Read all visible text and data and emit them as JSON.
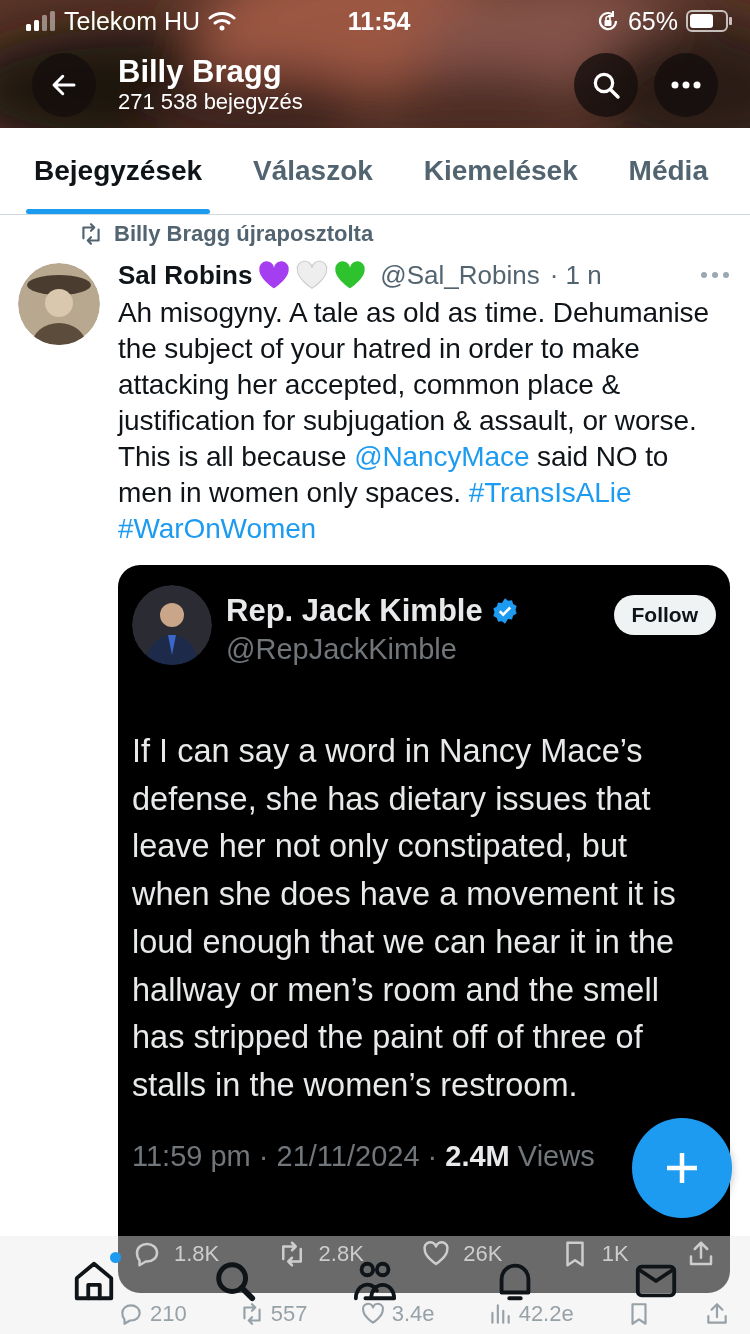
{
  "status_bar": {
    "carrier": "Telekom HU",
    "time": "11:54",
    "battery": "65%"
  },
  "header": {
    "title": "Billy Bragg",
    "subtitle": "271 538 bejegyzés"
  },
  "tabs": [
    {
      "label": "Bejegyzések",
      "selected": true
    },
    {
      "label": "Válaszok",
      "selected": false
    },
    {
      "label": "Kiemelések",
      "selected": false
    },
    {
      "label": "Média",
      "selected": false
    }
  ],
  "post": {
    "repost_label": "Billy Bragg újraposztolta",
    "author": "Sal Robins",
    "hearts": [
      {
        "color": "#a43ef0"
      },
      {
        "color": "#eeeeee"
      },
      {
        "color": "#2fc22f"
      }
    ],
    "handle": "@Sal_Robins",
    "time": "· 1 n",
    "text": [
      {
        "kind": "text",
        "text": "Ah misogyny. A tale as old as time. Dehumanise the subject of your hatred in order to make attacking her accepted, common place & justification for subjugation & assault, or worse. This is all because "
      },
      {
        "kind": "mention",
        "text": "@NancyMace"
      },
      {
        "kind": "text",
        "text": " said NO to men in women only spaces. "
      },
      {
        "kind": "hashtag",
        "text": "#TransIsALie"
      },
      {
        "kind": "hashtag",
        "text": "#WarOnWomen"
      }
    ],
    "quote": {
      "name": "Rep. Jack Kimble",
      "verified": true,
      "handle": "@RepJackKimble",
      "follow": "Follow",
      "text": "If I can say a word in Nancy Mace’s defense, she has dietary issues that leave her not only constipated, but when she does have a movement it is loud enough that we can hear it in the hallway or men’s room and the smell has stripped the paint off of three of stalls in the women’s restroom.",
      "meta": "11:59 pm · 21/11/2024 · ",
      "views_count": "2.4M",
      "views_label": " Views",
      "stats": [
        {
          "kind": "reply",
          "value": "1.8K"
        },
        {
          "kind": "repost",
          "value": "2.8K"
        },
        {
          "kind": "like",
          "value": "26K"
        },
        {
          "kind": "bookmark",
          "value": "1K"
        },
        {
          "kind": "share"
        }
      ]
    },
    "actions": [
      {
        "kind": "reply",
        "value": "210"
      },
      {
        "kind": "repost",
        "value": "557"
      },
      {
        "kind": "like",
        "value": "3.4e"
      },
      {
        "kind": "views",
        "value": "42.2e"
      },
      {
        "kind": "bookmark"
      },
      {
        "kind": "share"
      }
    ]
  },
  "bottom_nav": [
    {
      "kind": "home",
      "dot": true
    },
    {
      "kind": "search",
      "dot": false
    },
    {
      "kind": "people",
      "dot": false
    },
    {
      "kind": "bell",
      "dot": false
    },
    {
      "kind": "mail",
      "dot": false
    }
  ]
}
